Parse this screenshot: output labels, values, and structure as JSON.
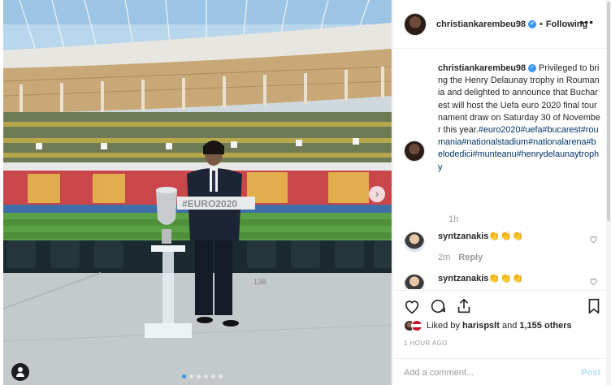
{
  "photo": {
    "scoreboard_text": "#EURO2020",
    "field_marking": "13B",
    "dots_total": 6,
    "dots_active": 0,
    "next_icon": "chevron-right-icon",
    "tag_icon": "person-tag-icon"
  },
  "header": {
    "username": "christiankarembeu98",
    "verified_icon": "verified-badge-icon",
    "separator": "•",
    "follow_label": "Following",
    "more_icon": "more-options-icon"
  },
  "caption": {
    "username": "christiankarembeu98",
    "body": "Privileged to bring the Henry Delaunay trophy in Roumania and delighted to announce that Bucharest will host the Uefa euro 2020 final tournament draw on Saturday 30 of November this year.",
    "hashtags": [
      "#euro2020",
      "#uefa",
      "#bucarest",
      "#roumania",
      "#nationalstadium",
      "#nationalarena",
      "#belodedici",
      "#munteanu",
      "#henrydelaunaytrophy"
    ],
    "time": "1h"
  },
  "comments": [
    {
      "username": "syntzanakis",
      "emoji": "👏👏👏",
      "time": "2m",
      "reply_label": "Reply"
    },
    {
      "username": "syntzanakis",
      "emoji": "👏👏👏",
      "time": "",
      "reply_label": ""
    }
  ],
  "actions": {
    "like_icon": "heart-icon",
    "comment_icon": "comment-icon",
    "share_icon": "share-icon",
    "save_icon": "bookmark-icon"
  },
  "likes": {
    "prefix": "Liked by",
    "user": "harispslt",
    "and": "and",
    "others": "1,155 others"
  },
  "posted": "1 HOUR AGO",
  "add_comment": {
    "placeholder": "Add a comment...",
    "post_label": "Post"
  },
  "colors": {
    "link": "#003569",
    "verified": "#3897f0",
    "muted": "#999999",
    "post_disabled": "#b2dffc"
  }
}
